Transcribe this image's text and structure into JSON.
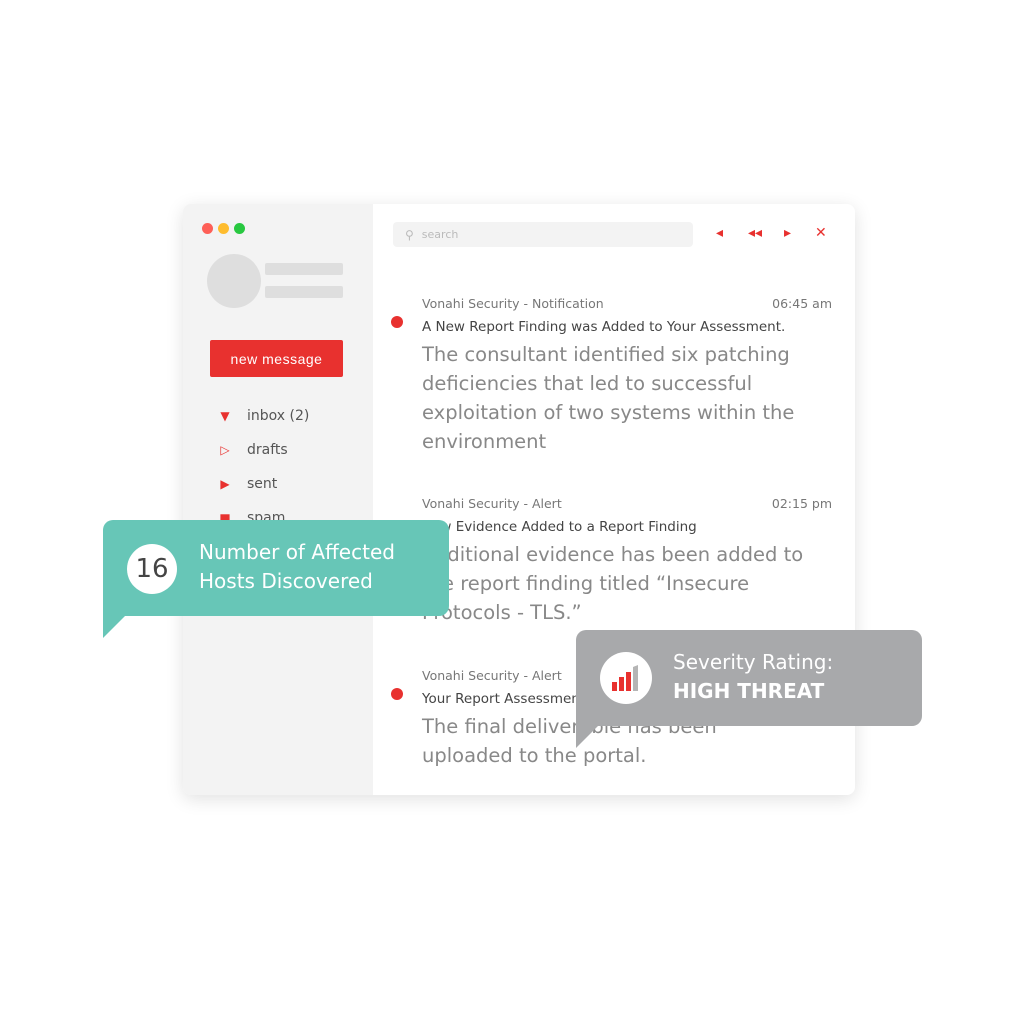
{
  "window": {
    "controls": [
      "#fe5f57",
      "#febc2e",
      "#28c840"
    ]
  },
  "sidebar": {
    "new_message": "new message",
    "folders": [
      {
        "label": "inbox (2)",
        "icon": "triangle-down-filled"
      },
      {
        "label": "drafts",
        "icon": "triangle-right-outline"
      },
      {
        "label": "sent",
        "icon": "triangle-right-filled"
      },
      {
        "label": "spam",
        "icon": "square-filled"
      }
    ]
  },
  "toolbar": {
    "search_placeholder": "search",
    "icons": [
      "prev-icon",
      "rewind-icon",
      "next-icon",
      "close-icon"
    ]
  },
  "messages": [
    {
      "from": "Vonahi Security - Notification",
      "time": "06:45 am",
      "subject": "A New Report Finding was Added to Your Assessment.",
      "body": "The consultant identified six patching deficiencies that led to successful exploitation of two systems within the environment",
      "unread": true
    },
    {
      "from": "Vonahi Security - Alert",
      "time": "02:15 pm",
      "subject": "New Evidence Added to a Report Finding",
      "body": "Additional evidence has been added to the report finding titled “Insecure Protocols - TLS.”",
      "unread": false
    },
    {
      "from": "Vonahi Security - Alert",
      "time": "",
      "subject": "Your Report Assessment",
      "body": "The final deliverable has been uploaded to the portal.",
      "unread": true
    }
  ],
  "callouts": {
    "hosts": {
      "count": "16",
      "text1": "Number of Affected",
      "text2": "Hosts Discovered",
      "color": "#67c6b7"
    },
    "severity": {
      "text1": "Severity Rating:",
      "text2": "HIGH THREAT",
      "color": "#a8a9ab",
      "level": "3 of 4 bars"
    }
  },
  "accent": "#e8312f"
}
